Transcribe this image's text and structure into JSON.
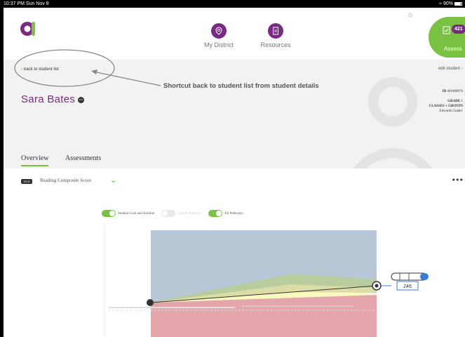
{
  "status_bar": {
    "time": "10:37 PM  Sun Nov 8",
    "battery": "90%"
  },
  "nav": [
    {
      "label": "My District",
      "icon": "location-pin-icon"
    },
    {
      "label": "Resources",
      "icon": "document-icon"
    }
  ],
  "assess": {
    "label": "Assess",
    "badge": "421"
  },
  "student": {
    "back_label": "back to student list",
    "edit_label": "edit student",
    "name": "Sara Bates",
    "badge": "PM",
    "id_label": "ID",
    "id_value": "401800076",
    "grade_label": "GRADE",
    "grade_value": "1",
    "classes_label": "CLASSES + GROUPS",
    "classes_value": "Edwards Grade1"
  },
  "annotation": {
    "text": "Shortcut back to student list from student details"
  },
  "tabs": [
    {
      "label": "Overview",
      "active": true
    },
    {
      "label": "Assessments",
      "active": false
    }
  ],
  "score": {
    "tag": "RCS",
    "label": "Reading Composite Score"
  },
  "toggles": [
    {
      "label": "Student Goal and Aimline",
      "on": true
    },
    {
      "label": "Current Pathway",
      "on": false
    },
    {
      "label": "All Pathways",
      "on": true
    }
  ],
  "chart": {
    "end_score": "246"
  },
  "colors": {
    "brand_purple": "#7b2a83",
    "brand_green": "#7ac143",
    "annotation_gray": "#888888"
  }
}
